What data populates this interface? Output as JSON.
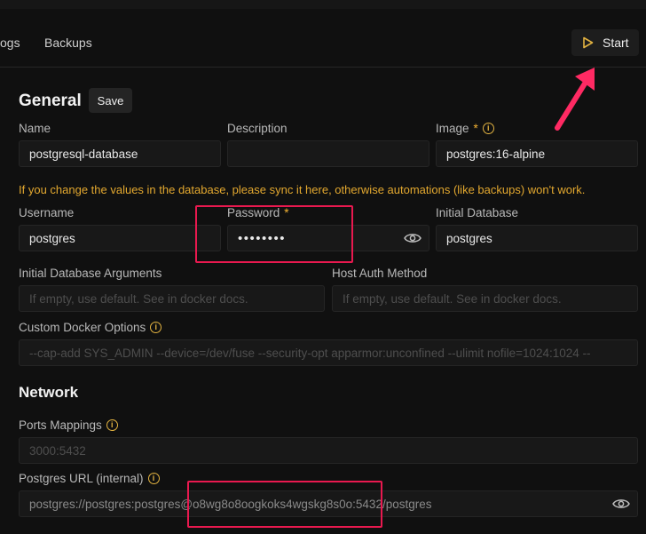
{
  "tabs": {
    "logs": "ogs",
    "backups": "Backups"
  },
  "toolbar": {
    "start_label": "Start"
  },
  "general": {
    "title": "General",
    "save_label": "Save",
    "name": {
      "label": "Name",
      "value": "postgresql-database"
    },
    "description": {
      "label": "Description",
      "value": ""
    },
    "image": {
      "label": "Image",
      "required": "*",
      "value": "postgres:16-alpine"
    },
    "warning": "If you change the values in the database, please sync it here, otherwise automations (like backups) won't work.",
    "username": {
      "label": "Username",
      "value": "postgres"
    },
    "password": {
      "label": "Password",
      "required": "*",
      "value": "••••••••"
    },
    "initial_database": {
      "label": "Initial Database",
      "value": "postgres"
    },
    "initdb_args": {
      "label": "Initial Database Arguments",
      "placeholder": "If empty, use default. See in docker docs."
    },
    "host_auth": {
      "label": "Host Auth Method",
      "placeholder": "If empty, use default. See in docker docs."
    },
    "custom_docker": {
      "label": "Custom Docker Options",
      "placeholder": "--cap-add SYS_ADMIN --device=/dev/fuse --security-opt apparmor:unconfined --ulimit nofile=1024:1024 --"
    }
  },
  "network": {
    "title": "Network",
    "ports": {
      "label": "Ports Mappings",
      "placeholder": "3000:5432"
    },
    "url_internal": {
      "label": "Postgres URL (internal)",
      "value": "postgres://postgres:postgres@o8wg8o8oogkoks4wgskg8s0o:5432/postgres"
    }
  },
  "colors": {
    "warning": "#e3a82f",
    "highlight": "#e8194f",
    "background": "#101010"
  }
}
